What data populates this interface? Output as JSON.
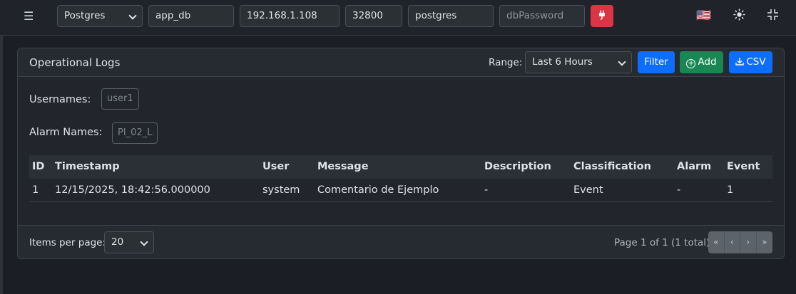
{
  "topbar": {
    "menu_icon": "hamburger-icon",
    "db_type": "Postgres",
    "database": "app_db",
    "host": "192.168.1.108",
    "port": "32800",
    "username": "postgres",
    "password_placeholder": "dbPassword",
    "connect_icon": "plug-icon",
    "language_flag": "🇺🇸",
    "theme_icon": "sun-icon",
    "collapse_icon": "compress-icon",
    "accent_danger": "#dc3545"
  },
  "panel": {
    "title": "Operational Logs",
    "range_label": "Range:",
    "range_value": "Last 6 Hours",
    "filter_label": "Filter",
    "add_label": "Add",
    "csv_label": "CSV",
    "usernames_label": "Usernames:",
    "usernames_chip": "user1",
    "alarms_label": "Alarm Names:",
    "alarms_chip": "PI_02_L"
  },
  "table": {
    "columns": [
      "ID",
      "Timestamp",
      "User",
      "Message",
      "Description",
      "Classification",
      "Alarm",
      "Event"
    ],
    "rows": [
      [
        "1",
        "12/15/2025, 18:42:56.000000",
        "system",
        "Comentario de Ejemplo",
        "-",
        "Event",
        "-",
        "1"
      ]
    ]
  },
  "footer": {
    "items_per_page_label": "Items per page:",
    "items_per_page": "20",
    "page_info": "Page 1 of 1 (1 total)",
    "pager": [
      "«",
      "‹",
      "›",
      "»"
    ]
  }
}
